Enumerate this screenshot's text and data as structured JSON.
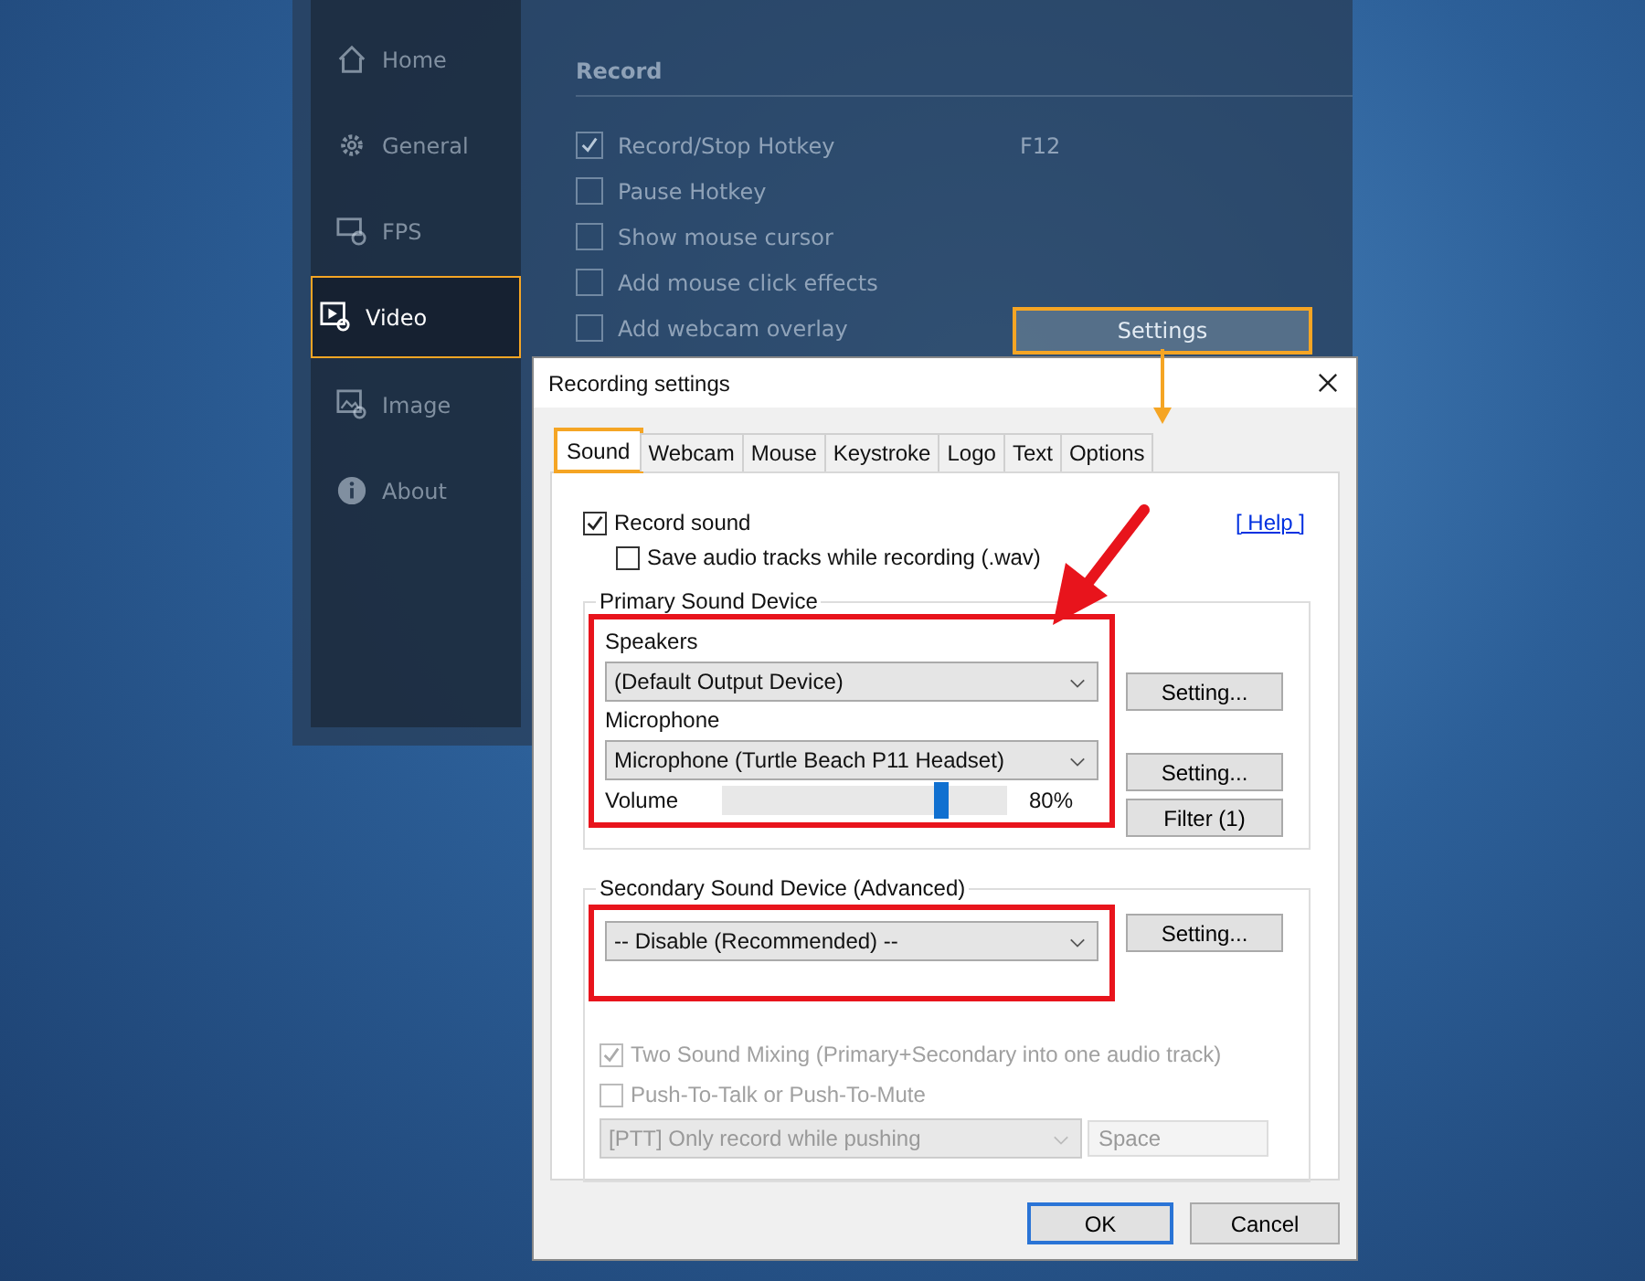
{
  "app": {
    "sidebar": [
      {
        "label": "Home",
        "kind": "home",
        "selected": false,
        "highlighted": false
      },
      {
        "label": "General",
        "kind": "general",
        "selected": false,
        "highlighted": false
      },
      {
        "label": "FPS",
        "kind": "fps",
        "selected": false,
        "highlighted": false
      },
      {
        "label": "Video",
        "kind": "video",
        "selected": true,
        "highlighted": true
      },
      {
        "label": "Image",
        "kind": "image",
        "selected": false,
        "highlighted": false
      },
      {
        "label": "About",
        "kind": "about",
        "selected": false,
        "highlighted": false
      }
    ],
    "section_title": "Record",
    "options": [
      {
        "label": "Record/Stop Hotkey",
        "checked": true,
        "value": "F12"
      },
      {
        "label": "Pause Hotkey",
        "checked": false
      },
      {
        "label": "Show mouse cursor",
        "checked": false
      },
      {
        "label": "Add mouse click effects",
        "checked": false
      },
      {
        "label": "Add webcam overlay",
        "checked": false
      }
    ],
    "settings_button": {
      "label": "Settings",
      "highlighted": true
    }
  },
  "dialog": {
    "title": "Recording settings",
    "tabs": [
      {
        "label": "Sound",
        "selected": true,
        "highlighted": true
      },
      {
        "label": "Webcam",
        "selected": false,
        "highlighted": false
      },
      {
        "label": "Mouse",
        "selected": false,
        "highlighted": false
      },
      {
        "label": "Keystroke",
        "selected": false,
        "highlighted": false
      },
      {
        "label": "Logo",
        "selected": false,
        "highlighted": false
      },
      {
        "label": "Text",
        "selected": false,
        "highlighted": false
      },
      {
        "label": "Options",
        "selected": false,
        "highlighted": false
      }
    ],
    "record_sound": {
      "label": "Record sound",
      "checked": true
    },
    "save_tracks": {
      "label": "Save audio tracks while recording (.wav)",
      "checked": false
    },
    "help_link": "[ Help ]",
    "primary": {
      "title": "Primary Sound Device",
      "speakers_label": "Speakers",
      "speakers": "(Default Output Device)",
      "speakers_button": "Setting...",
      "mic_label": "Microphone",
      "mic": "Microphone (Turtle Beach P11 Headset)",
      "mic_button": "Setting...",
      "volume_label": "Volume",
      "level": 0.8,
      "volume_reading": "80%",
      "filter_button": "Filter (1)"
    },
    "secondary": {
      "title": "Secondary Sound Device (Advanced)",
      "device": "-- Disable (Recommended) --",
      "button": "Setting..."
    },
    "two_sound": {
      "label": "Two Sound Mixing (Primary+Secondary into one audio track)",
      "checked": true,
      "disabled": true
    },
    "ptt": {
      "label": "Push-To-Talk or Push-To-Mute",
      "checked": false,
      "disabled": true
    },
    "ptt_mode": "[PTT] Only record while pushing",
    "ptt_key": "Space",
    "buttons": [
      {
        "label": "OK",
        "default": true
      },
      {
        "label": "Cancel",
        "default": false
      }
    ]
  }
}
